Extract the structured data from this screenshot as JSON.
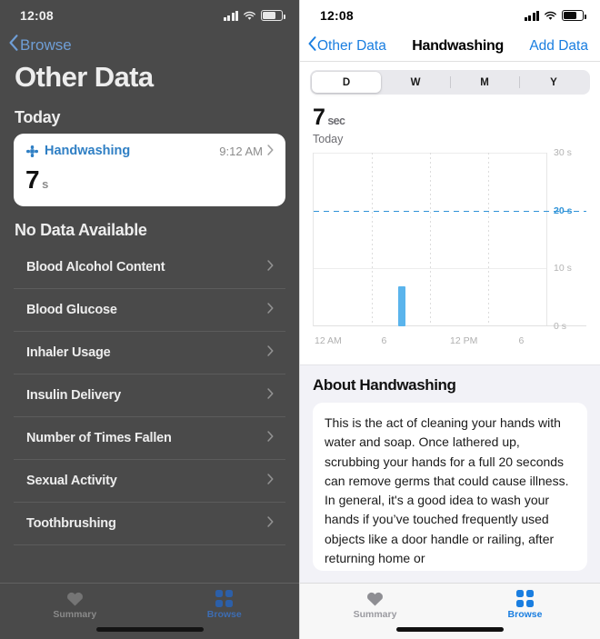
{
  "left": {
    "status": {
      "time": "12:08",
      "signal_icon": "cellular-signal-icon",
      "wifi_icon": "wifi-icon",
      "battery_icon": "battery-icon"
    },
    "back_label": "Browse",
    "title": "Other Data",
    "today_header": "Today",
    "card": {
      "icon": "handwashing-icon",
      "title": "Handwashing",
      "time": "9:12 AM",
      "value": "7",
      "unit": "s",
      "chevron_icon": "chevron-right-icon"
    },
    "no_data_header": "No Data Available",
    "rows": [
      {
        "label": "Blood Alcohol Content"
      },
      {
        "label": "Blood Glucose"
      },
      {
        "label": "Inhaler Usage"
      },
      {
        "label": "Insulin Delivery"
      },
      {
        "label": "Number of Times Fallen"
      },
      {
        "label": "Sexual Activity"
      },
      {
        "label": "Toothbrushing"
      }
    ],
    "tabs": [
      {
        "label": "Summary",
        "icon": "heart-icon",
        "active": false
      },
      {
        "label": "Browse",
        "icon": "grid-icon",
        "active": true
      }
    ]
  },
  "right": {
    "status": {
      "time": "12:08",
      "signal_icon": "cellular-signal-icon",
      "wifi_icon": "wifi-icon",
      "battery_icon": "battery-icon"
    },
    "nav": {
      "back_label": "Other Data",
      "back_icon": "chevron-left-icon",
      "title": "Handwashing",
      "action_label": "Add Data"
    },
    "segments": [
      {
        "label": "D",
        "active": true
      },
      {
        "label": "W",
        "active": false
      },
      {
        "label": "M",
        "active": false
      },
      {
        "label": "Y",
        "active": false
      }
    ],
    "stat": {
      "value": "7",
      "unit": "sec",
      "subtitle": "Today"
    },
    "about": {
      "heading": "About Handwashing",
      "body": "This is the act of cleaning your hands with water and soap. Once lathered up, scrubbing your hands for a full 20 seconds can remove germs that could cause illness. In general, it's a good idea to wash your hands if you’ve touched frequently used objects like a door handle or railing, after returning home or"
    },
    "tabs": [
      {
        "label": "Summary",
        "icon": "heart-icon",
        "active": false
      },
      {
        "label": "Browse",
        "icon": "grid-icon",
        "active": true
      }
    ]
  },
  "colors": {
    "accent_blue": "#1a7ee0",
    "bar_blue": "#5ab4ec",
    "goal_blue": "#2f93d8",
    "dim_overlay": "#4a4a4a",
    "group_bg": "#f2f2f7"
  },
  "chart_data": {
    "type": "bar",
    "title": "Handwashing duration — Today",
    "xlabel": "",
    "ylabel": "seconds",
    "ylim": [
      0,
      30
    ],
    "yticks": [
      0,
      10,
      20,
      30
    ],
    "ytick_labels": [
      "0 s",
      "10 s",
      "20 s",
      "30 s"
    ],
    "x": [
      "12 AM",
      "6",
      "12 PM",
      "6"
    ],
    "xtick_labels": [
      "12 AM",
      "6",
      "12 PM",
      "6"
    ],
    "x_hours": [
      0,
      6,
      12,
      18
    ],
    "grid": true,
    "legend": false,
    "goal_line": {
      "value": 20,
      "label": "20 s",
      "style": "dashed",
      "color": "#2f93d8"
    },
    "bars": [
      {
        "hour": 9.2,
        "time": "9:12 AM",
        "value": 7
      }
    ],
    "values": [
      7
    ],
    "categories": [
      "9:12 AM"
    ]
  }
}
